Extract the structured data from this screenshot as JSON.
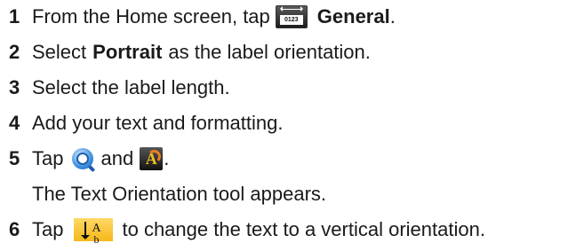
{
  "steps": [
    {
      "number": "1",
      "text_before": "From the Home screen, tap",
      "bold": "General",
      "text_after": ".",
      "icon": "general-label-icon",
      "icon_text": "0123"
    },
    {
      "number": "2",
      "text_before": "Select",
      "bold": "Portrait",
      "text_after": "as the label orientation."
    },
    {
      "number": "3",
      "text": "Select the label length."
    },
    {
      "number": "4",
      "text": "Add your text and formatting."
    },
    {
      "number": "5",
      "text_before": "Tap",
      "text_middle": "and",
      "text_after": ".",
      "icons": [
        "zoom-icon",
        "text-orientation-icon"
      ]
    },
    {
      "note": "The Text Orientation tool appears."
    },
    {
      "number": "6",
      "text_before": "Tap",
      "text_after": "to change the text to a vertical orientation.",
      "icon": "vertical-orientation-icon"
    }
  ],
  "colors": {
    "text": "#1a1a1a",
    "vertical_icon_bg": "#f5b81a",
    "zoom_icon": "#3b8fe0"
  }
}
